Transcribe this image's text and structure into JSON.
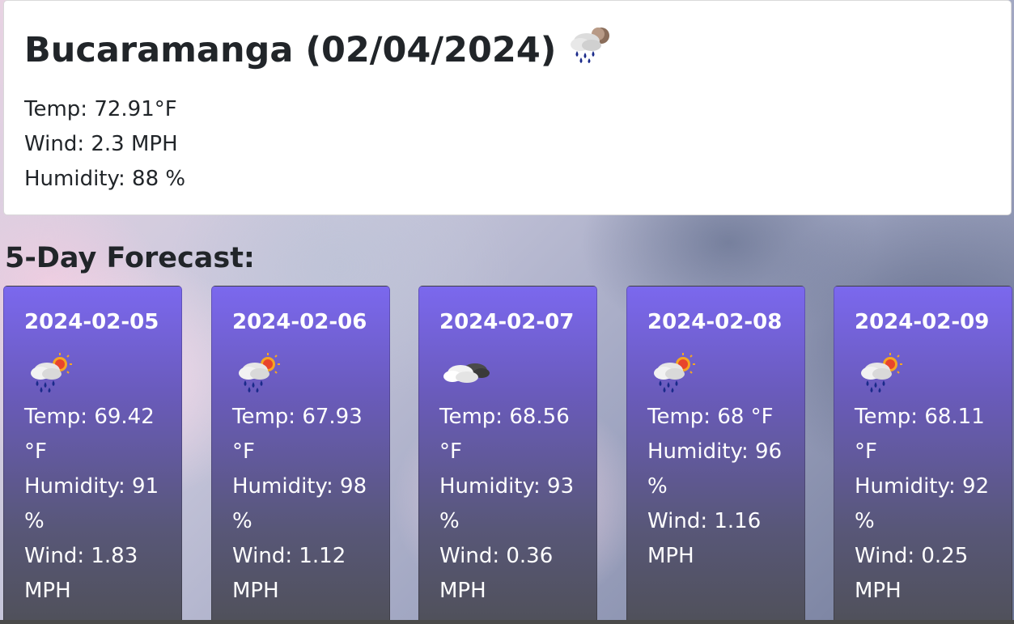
{
  "current": {
    "title": "Bucaramanga (02/04/2024)",
    "icon": "rain-cloud-night-icon",
    "temp": "Temp: 72.91°F",
    "wind": "Wind: 2.3 MPH",
    "humidity": "Humidity: 88 %"
  },
  "forecast": {
    "heading": "5-Day Forecast:",
    "days": [
      {
        "date": "2024-02-05",
        "icon": "rain-cloud-sun-icon",
        "temp": "Temp: 69.42",
        "temp_unit": "°F",
        "humidity": "Humidity: 91",
        "humidity_unit": "%",
        "wind": "Wind: 1.83",
        "wind_unit": "MPH"
      },
      {
        "date": "2024-02-06",
        "icon": "rain-cloud-sun-icon",
        "temp": "Temp: 67.93",
        "temp_unit": "°F",
        "humidity": "Humidity: 98",
        "humidity_unit": "%",
        "wind": "Wind: 1.12",
        "wind_unit": "MPH"
      },
      {
        "date": "2024-02-07",
        "icon": "overcast-clouds-icon",
        "temp": "Temp: 68.56",
        "temp_unit": "°F",
        "humidity": "Humidity: 93",
        "humidity_unit": "%",
        "wind": "Wind: 0.36",
        "wind_unit": "MPH"
      },
      {
        "date": "2024-02-08",
        "icon": "rain-cloud-sun-icon",
        "temp": "Temp: 68 °F",
        "humidity": "Humidity: 96",
        "humidity_unit": "%",
        "wind": "Wind: 1.16",
        "wind_unit": "MPH"
      },
      {
        "date": "2024-02-09",
        "icon": "rain-cloud-sun-icon",
        "temp": "Temp: 68.11",
        "temp_unit": "°F",
        "humidity": "Humidity: 92",
        "humidity_unit": "%",
        "wind": "Wind: 0.25",
        "wind_unit": "MPH"
      }
    ]
  }
}
